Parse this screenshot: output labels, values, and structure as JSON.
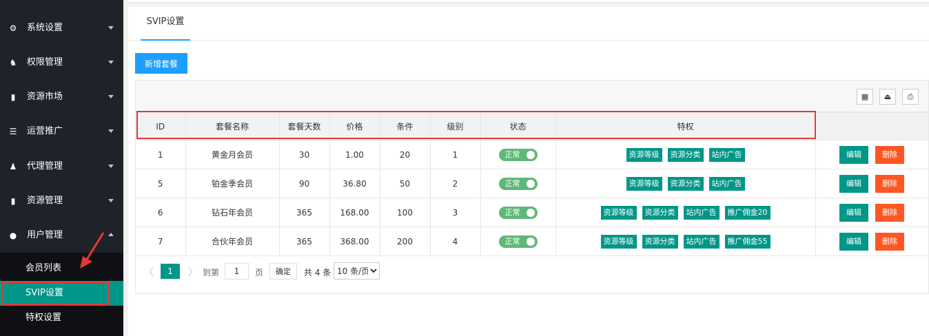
{
  "sidebar": {
    "items": [
      {
        "label": "系统设置",
        "icon": "gear-icon",
        "glyph": "⚙"
      },
      {
        "label": "权限管理",
        "icon": "permission-icon",
        "glyph": "♞"
      },
      {
        "label": "资源市场",
        "icon": "book-icon",
        "glyph": "▮"
      },
      {
        "label": "运营推广",
        "icon": "list-icon",
        "glyph": "☰"
      },
      {
        "label": "代理管理",
        "icon": "users-icon",
        "glyph": "♟"
      },
      {
        "label": "资源管理",
        "icon": "book-icon",
        "glyph": "▮"
      },
      {
        "label": "用户管理",
        "icon": "user-icon",
        "glyph": "●"
      }
    ],
    "subitems": [
      {
        "label": "会员列表"
      },
      {
        "label": "SVIP设置"
      },
      {
        "label": "特权设置"
      }
    ]
  },
  "tab": {
    "label": "SVIP设置"
  },
  "toolbar": {
    "add_label": "新增套餐"
  },
  "table": {
    "headers": [
      "ID",
      "套餐名称",
      "套餐天数",
      "价格",
      "条件",
      "级别",
      "状态",
      "特权",
      ""
    ],
    "rows": [
      {
        "id": "1",
        "name": "黄金月会员",
        "days": "30",
        "price": "1.00",
        "condition": "20",
        "level": "1",
        "status": "正常",
        "privileges": [
          "资源等级",
          "资源分类",
          "站内广告"
        ]
      },
      {
        "id": "5",
        "name": "铂金季会员",
        "days": "90",
        "price": "36.80",
        "condition": "50",
        "level": "2",
        "status": "正常",
        "privileges": [
          "资源等级",
          "资源分类",
          "站内广告"
        ]
      },
      {
        "id": "6",
        "name": "钻石年会员",
        "days": "365",
        "price": "168.00",
        "condition": "100",
        "level": "3",
        "status": "正常",
        "privileges": [
          "资源等级",
          "资源分类",
          "站内广告",
          "推广佣金20"
        ]
      },
      {
        "id": "7",
        "name": "合伙年会员",
        "days": "365",
        "price": "368.00",
        "condition": "200",
        "level": "4",
        "status": "正常",
        "privileges": [
          "资源等级",
          "资源分类",
          "站内广告",
          "推广佣金55"
        ]
      }
    ],
    "edit_label": "编辑",
    "delete_label": "删除"
  },
  "pagination": {
    "prev": "〈",
    "current": "1",
    "next": "〉",
    "goto_label": "到第",
    "goto_value": "1",
    "page_label": "页",
    "confirm_label": "确定",
    "total_label": "共 4 条",
    "page_size": "10 条/页"
  },
  "colors": {
    "sidebar_bg": "#20222a",
    "accent": "#009688",
    "primary": "#1e9fff",
    "danger": "#ff5722",
    "switch_on": "#5fb878",
    "highlight_box": "#e53935"
  }
}
